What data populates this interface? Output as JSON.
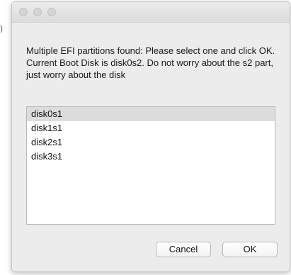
{
  "background_fragment": {
    "text": ")"
  },
  "dialog": {
    "message": "Multiple EFI partitions found: Please select one and click OK. Current Boot Disk is disk0s2. Do not worry about the s2 part, just worry about the disk",
    "list": {
      "selected_index": 0,
      "items": [
        "disk0s1",
        "disk1s1",
        "disk2s1",
        "disk3s1"
      ]
    },
    "buttons": {
      "cancel_label": "Cancel",
      "ok_label": "OK"
    }
  }
}
